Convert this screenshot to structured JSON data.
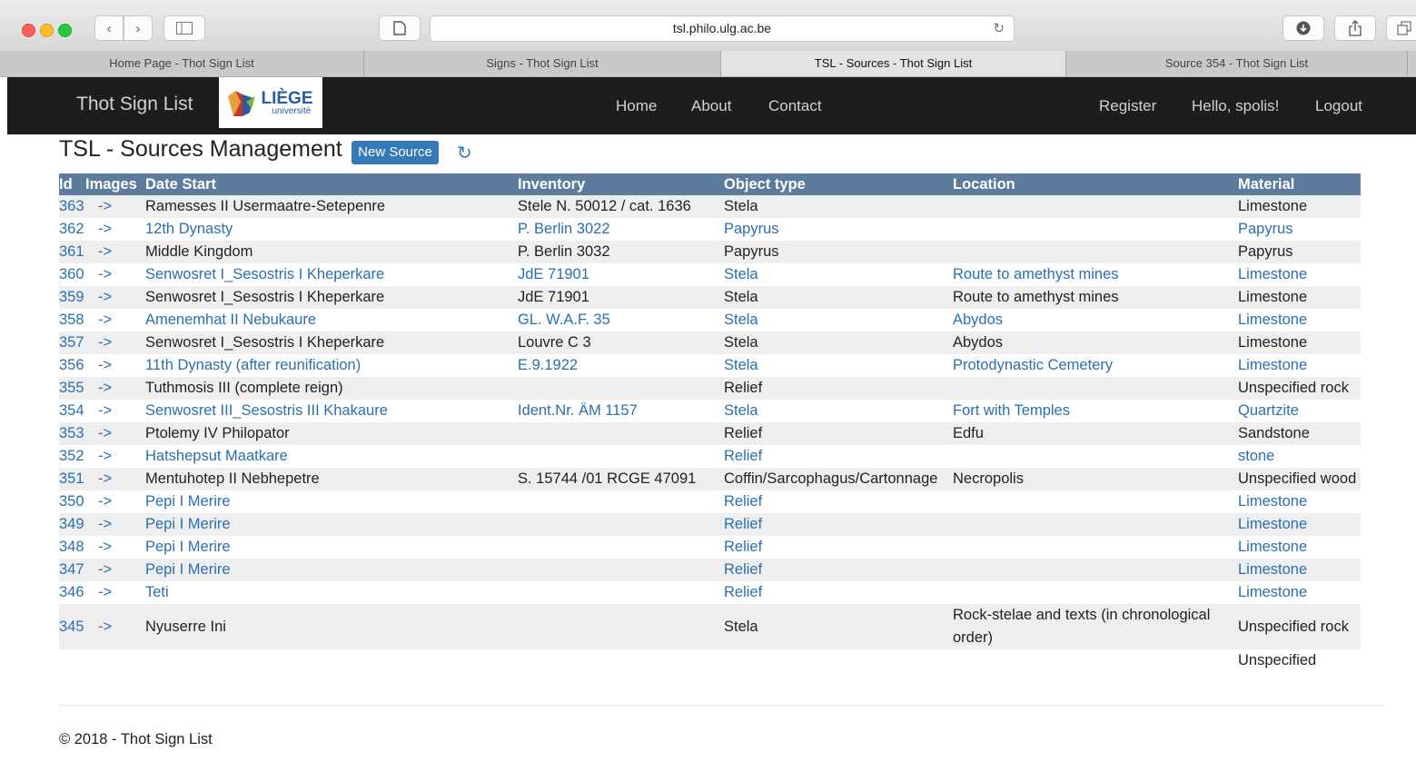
{
  "browser": {
    "url": "tsl.philo.ulg.ac.be",
    "tabs": [
      {
        "label": "Home Page - Thot Sign List",
        "active": false
      },
      {
        "label": "Signs - Thot Sign List",
        "active": false
      },
      {
        "label": "TSL - Sources - Thot Sign List",
        "active": true
      },
      {
        "label": "Source 354 - Thot Sign List",
        "active": false
      }
    ]
  },
  "navbar": {
    "brand": "Thot Sign List",
    "logo_top": "LIÈGE",
    "logo_bottom": "université",
    "home": "Home",
    "about": "About",
    "contact": "Contact",
    "register": "Register",
    "hello": "Hello, spolis!",
    "logout": "Logout"
  },
  "page": {
    "title": "TSL - Sources Management",
    "new_source": "New Source"
  },
  "table": {
    "headers": [
      "Id",
      "Images",
      "Date Start",
      "Inventory",
      "Object type",
      "Location",
      "Material"
    ],
    "rows": [
      {
        "id": "363",
        "img": "->",
        "date": "Ramesses II Usermaatre-Setepenre",
        "inv": "Stele N. 50012 / cat. 1636",
        "obj": "Stela",
        "loc": "",
        "mat": "Limestone",
        "links": [
          0
        ]
      },
      {
        "id": "362",
        "img": "->",
        "date": "12th Dynasty",
        "inv": "P. Berlin 3022",
        "obj": "Papyrus",
        "loc": "",
        "mat": "Papyrus",
        "links": [
          0,
          2,
          3,
          4,
          6
        ]
      },
      {
        "id": "361",
        "img": "->",
        "date": "Middle Kingdom",
        "inv": "P. Berlin 3032",
        "obj": "Papyrus",
        "loc": "",
        "mat": "Papyrus",
        "links": [
          0
        ]
      },
      {
        "id": "360",
        "img": "->",
        "date": "Senwosret I_Sesostris I Kheperkare",
        "inv": "JdE 71901",
        "obj": "Stela",
        "loc": "Route to amethyst mines",
        "mat": "Limestone",
        "links": [
          0,
          2,
          3,
          4,
          5,
          6
        ]
      },
      {
        "id": "359",
        "img": "->",
        "date": "Senwosret I_Sesostris I Kheperkare",
        "inv": "JdE 71901",
        "obj": "Stela",
        "loc": "Route to amethyst mines",
        "mat": "Limestone",
        "links": [
          0
        ]
      },
      {
        "id": "358",
        "img": "->",
        "date": "Amenemhat II Nebukaure",
        "inv": "GL. W.A.F. 35",
        "obj": "Stela",
        "loc": "Abydos",
        "mat": "Limestone",
        "links": [
          0,
          2,
          3,
          4,
          5,
          6
        ]
      },
      {
        "id": "357",
        "img": "->",
        "date": "Senwosret I_Sesostris I Kheperkare",
        "inv": "Louvre C 3",
        "obj": "Stela",
        "loc": "Abydos",
        "mat": "Limestone",
        "links": [
          0
        ]
      },
      {
        "id": "356",
        "img": "->",
        "date": "11th Dynasty (after reunification)",
        "inv": "E.9.1922",
        "obj": "Stela",
        "loc": "Protodynastic Cemetery",
        "mat": "Limestone",
        "links": [
          0,
          2,
          3,
          4,
          5,
          6
        ]
      },
      {
        "id": "355",
        "img": "->",
        "date": "Tuthmosis III (complete reign)",
        "inv": "",
        "obj": "Relief",
        "loc": "",
        "mat": "Unspecified rock",
        "links": [
          0
        ]
      },
      {
        "id": "354",
        "img": "->",
        "date": "Senwosret III_Sesostris III Khakaure",
        "inv": "Ident.Nr. ÄM 1157",
        "obj": "Stela",
        "loc": "Fort with Temples",
        "mat": "Quartzite",
        "links": [
          0,
          2,
          3,
          4,
          5,
          6
        ]
      },
      {
        "id": "353",
        "img": "->",
        "date": "Ptolemy IV Philopator",
        "inv": "",
        "obj": "Relief",
        "loc": "Edfu",
        "mat": "Sandstone",
        "links": [
          0
        ]
      },
      {
        "id": "352",
        "img": "->",
        "date": "Hatshepsut Maatkare",
        "inv": "",
        "obj": "Relief",
        "loc": "",
        "mat": "stone",
        "links": [
          0,
          2,
          4,
          6
        ]
      },
      {
        "id": "351",
        "img": "->",
        "date": "Mentuhotep II Nebhepetre",
        "inv": "S. 15744 /01 RCGE 47091",
        "obj": "Coffin/Sarcophagus/Cartonnage",
        "loc": "Necropolis",
        "mat": "Unspecified wood",
        "links": [
          0
        ]
      },
      {
        "id": "350",
        "img": "->",
        "date": "Pepi I Merire",
        "inv": "",
        "obj": "Relief",
        "loc": "",
        "mat": "Limestone",
        "links": [
          0,
          2,
          4,
          6
        ]
      },
      {
        "id": "349",
        "img": "->",
        "date": "Pepi I Merire",
        "inv": "",
        "obj": "Relief",
        "loc": "",
        "mat": "Limestone",
        "links": [
          0,
          2,
          4,
          6
        ]
      },
      {
        "id": "348",
        "img": "->",
        "date": "Pepi I Merire",
        "inv": "",
        "obj": "Relief",
        "loc": "",
        "mat": "Limestone",
        "links": [
          0,
          2,
          4,
          6
        ]
      },
      {
        "id": "347",
        "img": "->",
        "date": "Pepi I Merire",
        "inv": "",
        "obj": "Relief",
        "loc": "",
        "mat": "Limestone",
        "links": [
          0,
          2,
          4,
          6
        ]
      },
      {
        "id": "346",
        "img": "->",
        "date": "Teti",
        "inv": "",
        "obj": "Relief",
        "loc": "",
        "mat": "Limestone",
        "links": [
          0,
          2,
          4,
          6
        ]
      },
      {
        "id": "345",
        "img": "->",
        "date": "Nyuserre Ini",
        "inv": "",
        "obj": "Stela",
        "loc": "Rock-stelae and texts (in chronological order)",
        "mat": "Unspecified rock",
        "links": [
          0
        ]
      },
      {
        "id": "",
        "img": "",
        "date": "",
        "inv": "",
        "obj": "",
        "loc": "",
        "mat": "Unspecified",
        "links": []
      }
    ]
  },
  "footer": {
    "text": "© 2018 - Thot Sign List"
  },
  "colors": {
    "header_bg": "#5d7c9d",
    "link": "#2a6fb1",
    "navbar": "#1d1d1d",
    "button": "#337ab7"
  },
  "icons": [
    "back-icon",
    "forward-icon",
    "sidebar-icon",
    "page-icon",
    "reload-icon",
    "download-icon",
    "share-icon",
    "tabs-icon",
    "refresh-icon"
  ]
}
